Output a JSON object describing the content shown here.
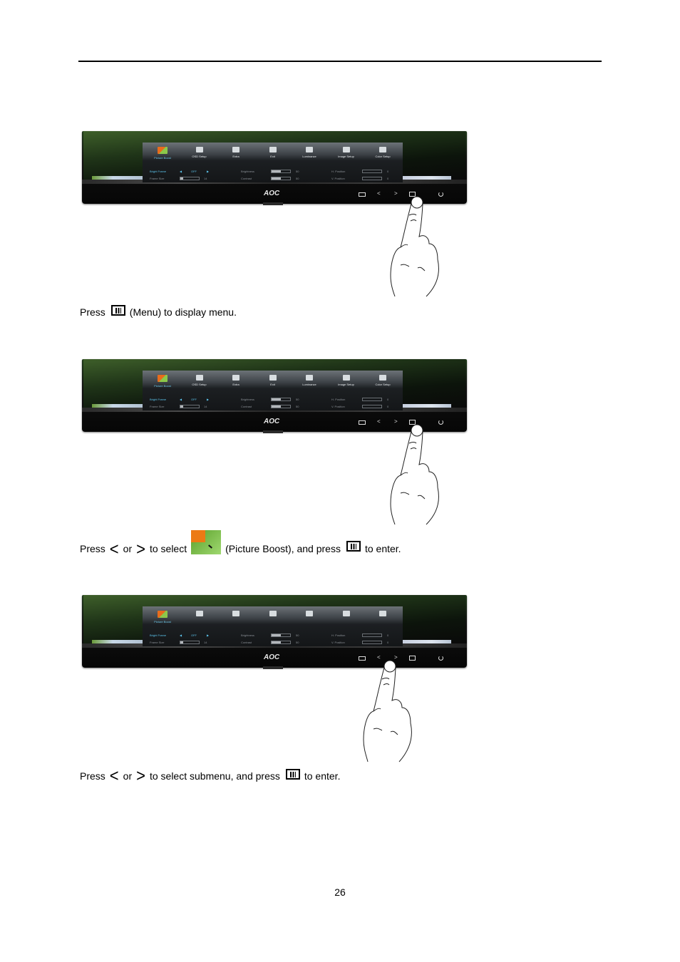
{
  "page": {
    "number": "26"
  },
  "osd_menu": {
    "tabs": [
      {
        "label": "Picture Boost",
        "icon": "picture-boost-icon",
        "active": true
      },
      {
        "label": "OSD Setup",
        "icon": "osd-setup-icon"
      },
      {
        "label": "Extra",
        "icon": "extra-icon"
      },
      {
        "label": "Exit",
        "icon": "exit-icon"
      },
      {
        "label": "Luminance",
        "icon": "luminance-icon"
      },
      {
        "label": "Image Setup",
        "icon": "image-setup-icon"
      },
      {
        "label": "Color Setup",
        "icon": "color-setup-icon"
      }
    ],
    "bright_frame": {
      "label": "Bright Frame",
      "value": "OFF"
    },
    "frame_size": {
      "label": "Frame Size",
      "value": "14",
      "level": 0.15
    },
    "brightness": {
      "label": "Brightness",
      "value": "50",
      "level": 0.5
    },
    "contrast": {
      "label": "Contrast",
      "value": "50",
      "level": 0.5
    },
    "h_position": {
      "label": "H. Position",
      "value": "0",
      "level": 0
    },
    "v_position": {
      "label": "V. Position",
      "value": "0",
      "level": 0
    }
  },
  "monitor": {
    "brand": "AOC",
    "buttons": {
      "auto": "auto-icon",
      "left": "<",
      "right": ">",
      "menu": "menu-icon",
      "power": "power-icon"
    }
  },
  "steps": [
    {
      "pre": "Press",
      "post": "(Menu) to display menu.",
      "pressed_button": "menu"
    },
    {
      "pre": "Press",
      "or": "or",
      "to_select": "to select",
      "icon_label": "(Picture Boost), and press",
      "post": "to enter.",
      "pressed_button": "menu"
    },
    {
      "pre": "Press",
      "or": "or",
      "to_select": "to select submenu, and press",
      "post": "to enter.",
      "pressed_button": "right"
    }
  ],
  "glyphs": {
    "left": "<",
    "right": ">"
  }
}
